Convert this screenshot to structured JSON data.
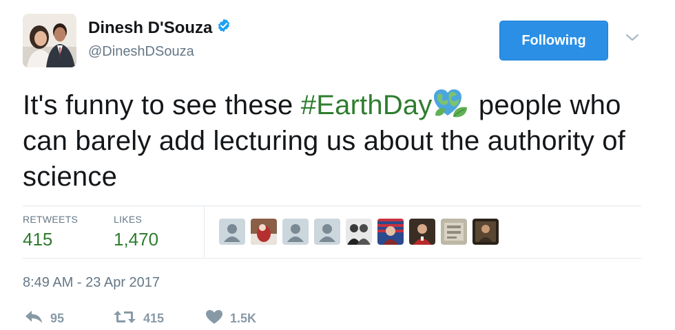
{
  "header": {
    "name": "Dinesh D'Souza",
    "handle": "@DineshDSouza",
    "follow_label": "Following",
    "verified_color": "#1da1f2"
  },
  "tweet": {
    "text_before": "It's funny to see these ",
    "hashtag": "#EarthDay",
    "emoji": "earth-heart-leaves-emoji",
    "text_after": " people who can barely add lecturing us about the authority of science"
  },
  "stats": {
    "retweets_label": "RETWEETS",
    "retweets_value": "415",
    "likes_label": "LIKES",
    "likes_value": "1,470",
    "liker_avatars": [
      "default-avatar",
      "photo-avatar",
      "default-avatar",
      "default-avatar",
      "photo-avatar",
      "photo-avatar",
      "photo-avatar",
      "photo-avatar",
      "photo-avatar"
    ]
  },
  "timestamp": "8:49 AM - 23 Apr 2017",
  "actions": {
    "reply_count": "95",
    "retweet_count": "415",
    "like_count": "1.5K"
  },
  "colors": {
    "accent": "#2b8fe5",
    "hashtag": "#2e7d2e",
    "muted": "#657786"
  }
}
